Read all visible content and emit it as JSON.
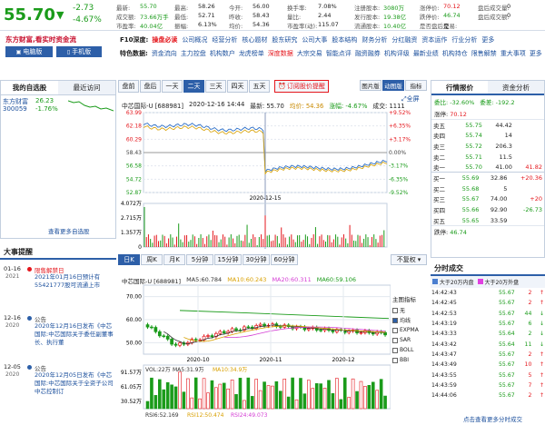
{
  "quote": {
    "price": "55.70",
    "arrow": "▼",
    "change": "-2.73",
    "pct": "-4.67%"
  },
  "stats": [
    [
      "最新:",
      "55.70",
      "最高:",
      "58.26",
      "今开:",
      "56.00",
      "换手率:",
      "7.08%",
      "注册股本:",
      "3080万",
      "涨停价:",
      "70.12",
      "盘后成交量:",
      "0"
    ],
    [
      "成交额:",
      "73.66万手",
      "最低:",
      "52.71",
      "昨收:",
      "58.43",
      "量比:",
      "2.44",
      "发行股本:",
      "19.38亿",
      "跌停价:",
      "46.74",
      "盘后成交额:",
      "0"
    ],
    [
      "市盈率:",
      "40.04亿",
      "振幅:",
      "6.13%",
      "均价:",
      "54.36",
      "市盈率(动):",
      "115.07",
      "流通股本:",
      "10.40亿",
      "是否盘后交易:",
      "是",
      "",
      ""
    ]
  ],
  "brand": {
    "logo": "东方财富,看实时资金流",
    "pc": "电脑版",
    "mobile": "手机版"
  },
  "nav1": {
    "label": "F10深度:",
    "items": [
      "操盘必读",
      "公司概况",
      "经营分析",
      "核心题材",
      "股东研究",
      "公司大事",
      "股本结构",
      "财务分析",
      "分红融资",
      "资本运作",
      "行业分析",
      "更多"
    ]
  },
  "nav2": {
    "label": "特色数据:",
    "items": [
      "资金流向",
      "主力控盘",
      "机构数户",
      "龙虎榜单",
      "深度数据",
      "大宗交易",
      "智能点评",
      "融资融券",
      "机构评级",
      "最新业绩",
      "机构持仓",
      "限售解禁",
      "重大事项",
      "更多"
    ]
  },
  "watchlist": {
    "tabs": [
      "我的自选股",
      "最近访问"
    ],
    "stock_name": "东方财富",
    "stock_code": "300059",
    "stock_price": "26.23",
    "stock_pct": "-1.76%",
    "more": "查看更多自选股"
  },
  "chart_tabs": [
    "盘前",
    "盘后",
    "一天",
    "二天",
    "三天",
    "四天",
    "五天"
  ],
  "chart_tabs_active": "二天",
  "recent_btn": "订阅股价提醒",
  "view_btns": [
    "图片版",
    "动图版",
    "指标"
  ],
  "fullscreen": "全屏",
  "intraday": {
    "title": "中芯国际-U [688981]",
    "time": "2020-12-16 14:44",
    "latest": "最新: 55.70",
    "avg": "均价: 54.36",
    "pct": "涨幅: -4.67%",
    "vol": "成交: 1111",
    "date_label": "2020-12-15",
    "left_ticks": [
      "63.99",
      "62.18",
      "60.29",
      "58.43",
      "56.58",
      "54.72",
      "52.87"
    ],
    "right_ticks": [
      "+9.52%",
      "+6.35%",
      "+3.17%",
      "0.00%",
      "-3.17%",
      "-6.35%",
      "-9.52%"
    ],
    "vol_ticks": [
      "4.072万",
      "2.715万",
      "1.357万",
      "0"
    ]
  },
  "period_tabs": [
    "日K",
    "周K",
    "月K",
    "5分钟",
    "15分钟",
    "30分钟",
    "60分钟"
  ],
  "period_active": "日K",
  "adjust": "不复权",
  "kline": {
    "title": "中芯国际-U [688981]",
    "ma5": "MA5:60.784",
    "ma10": "MA10:60.243",
    "ma20": "MA20:60.311",
    "ma60": "MA60:59.106",
    "y_ticks": [
      "70.00",
      "60.00",
      "50.00"
    ],
    "x_ticks": [
      "2020-10",
      "2020-11",
      "2020-12"
    ],
    "vol_label": "VOL:22万",
    "vol_ma5": "MA5:31.9万",
    "vol_ma10": "MA10:34.9万",
    "vol_ticks": [
      "91.57万",
      "61.05万",
      "30.52万"
    ],
    "rsi": "RSI6:52.169",
    "rsi12": "RSI12:50.474",
    "rsi24": "RSI24:49.073"
  },
  "indicators": {
    "title": "主图指标",
    "items": [
      "无",
      "均线",
      "EXPMA",
      "SAR",
      "BOLL",
      "BBI"
    ],
    "checked": "均线"
  },
  "news": {
    "header": "大事提醒",
    "items": [
      {
        "date": "01-16",
        "year": "2021",
        "tag": "限售解禁日",
        "text": "2021年01月16日预计有55421777股可流通上市"
      },
      {
        "date": "12-16",
        "year": "2020",
        "tag": "公告",
        "text": "2020年12月16日发布《中芯国际:中芯国际关于委任副董事长、执行董"
      },
      {
        "date": "12-05",
        "year": "2020",
        "tag": "公告",
        "text": "2020年12月05日发布《中芯国际:中芯国际关于全资子公司中芯控制订"
      }
    ]
  },
  "orderbook": {
    "tabs": [
      "行情报价",
      "资金分析"
    ],
    "wei_bi": "委比: -32.60%",
    "wei_cha": "委差: -192.2",
    "limit_up_label": "涨停: ",
    "limit_up": "70.12",
    "asks": [
      [
        "卖五",
        "55.75",
        "44.42",
        ""
      ],
      [
        "卖四",
        "55.74",
        "14",
        ""
      ],
      [
        "卖三",
        "55.72",
        "206.3",
        ""
      ],
      [
        "卖二",
        "55.71",
        "11.5",
        ""
      ],
      [
        "卖一",
        "55.70",
        "41.00",
        "41.82"
      ]
    ],
    "bids": [
      [
        "买一",
        "55.69",
        "32.86",
        "+20.36"
      ],
      [
        "买二",
        "55.68",
        "5",
        ""
      ],
      [
        "买三",
        "55.67",
        "74.00",
        "+20"
      ],
      [
        "买四",
        "55.66",
        "92.90",
        "-26.73"
      ],
      [
        "买五",
        "55.65",
        "33.59",
        ""
      ]
    ],
    "limit_down_label": "跌停: ",
    "limit_down": "46.74"
  },
  "ticks": {
    "header": "分时成交",
    "legend_big_buy": "大于20万内盘",
    "legend_big_sell": "大于20万外盘",
    "more": "点击查看更多分时成交",
    "rows": [
      [
        "14:42:43",
        "55.67",
        "2",
        "↑"
      ],
      [
        "14:42:45",
        "55.67",
        "2",
        "↑"
      ],
      [
        "14:42:53",
        "55.67",
        "44",
        "↓"
      ],
      [
        "14:43:19",
        "55.67",
        "6",
        "↓"
      ],
      [
        "14:43:33",
        "55.64",
        "2",
        "↓"
      ],
      [
        "14:43:42",
        "55.64",
        "11",
        "↓"
      ],
      [
        "14:43:47",
        "55.67",
        "2",
        "↑"
      ],
      [
        "14:43:49",
        "55.67",
        "10",
        "↑"
      ],
      [
        "14:43:55",
        "55.67",
        "5",
        "↑"
      ],
      [
        "14:43:59",
        "55.67",
        "7",
        "↑"
      ],
      [
        "14:44:06",
        "55.67",
        "2",
        "↑"
      ]
    ]
  }
}
